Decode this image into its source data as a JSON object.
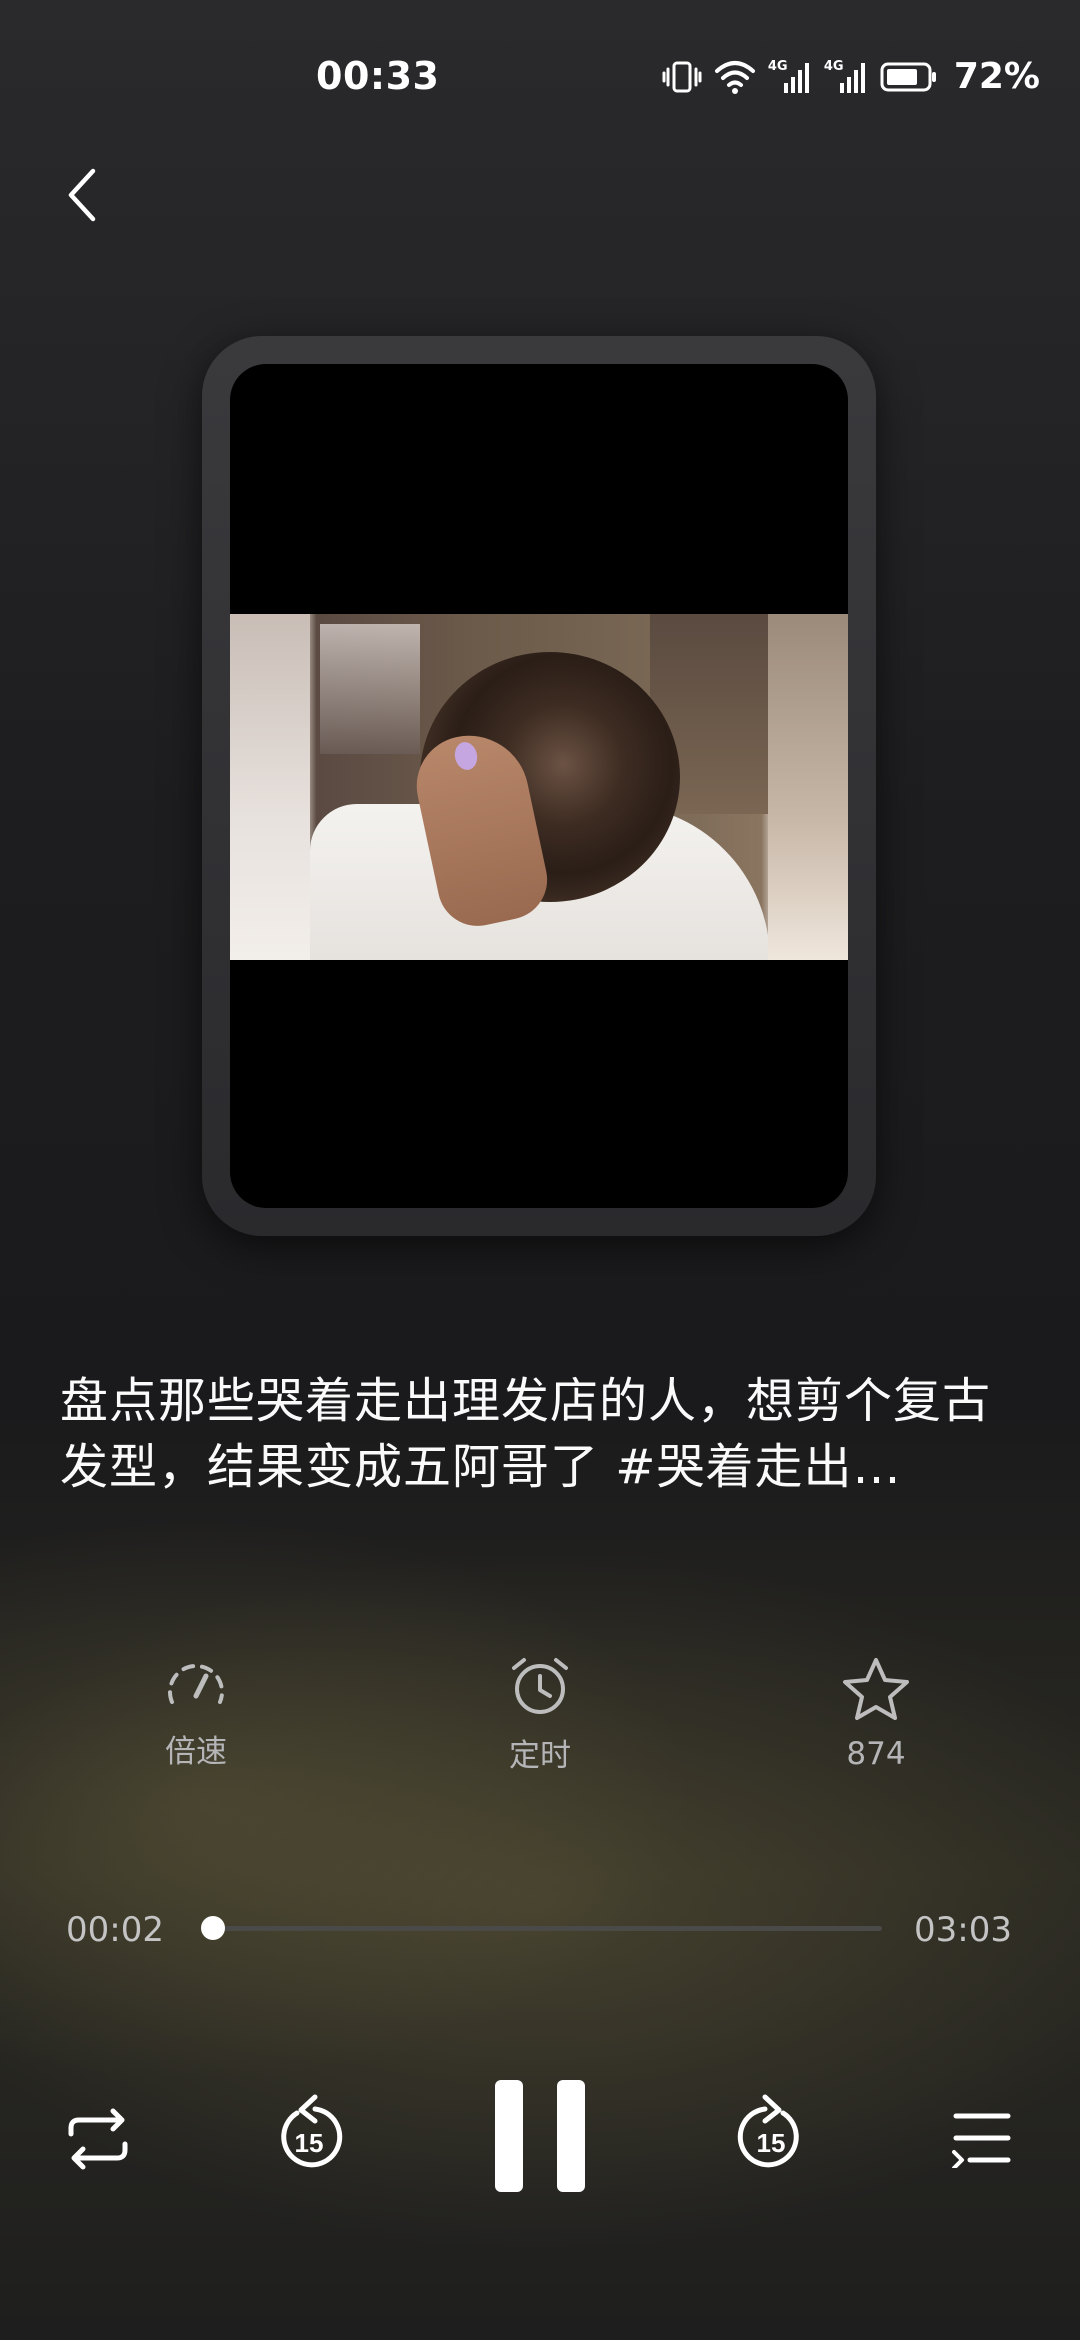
{
  "status_bar": {
    "time": "00:33",
    "signal_1_label": "4G",
    "signal_2_label": "4G",
    "battery_percent": "72%"
  },
  "player": {
    "title": "盘点那些哭着走出理发店的人，想剪个复古发型，结果变成五阿哥了 #哭着走出…",
    "actions": {
      "speed_label": "倍速",
      "timer_label": "定时",
      "favorite_count": "874"
    },
    "progress": {
      "current_time": "00:02",
      "total_time": "03:03",
      "fraction": 0.011
    },
    "controls": {
      "rewind_seconds": "15",
      "forward_seconds": "15",
      "state": "playing"
    }
  },
  "colors": {
    "background": "#1b1b1d",
    "text_primary": "#fafafa",
    "text_secondary": "#b5b5b8",
    "progress_track": "#4a4a48"
  }
}
